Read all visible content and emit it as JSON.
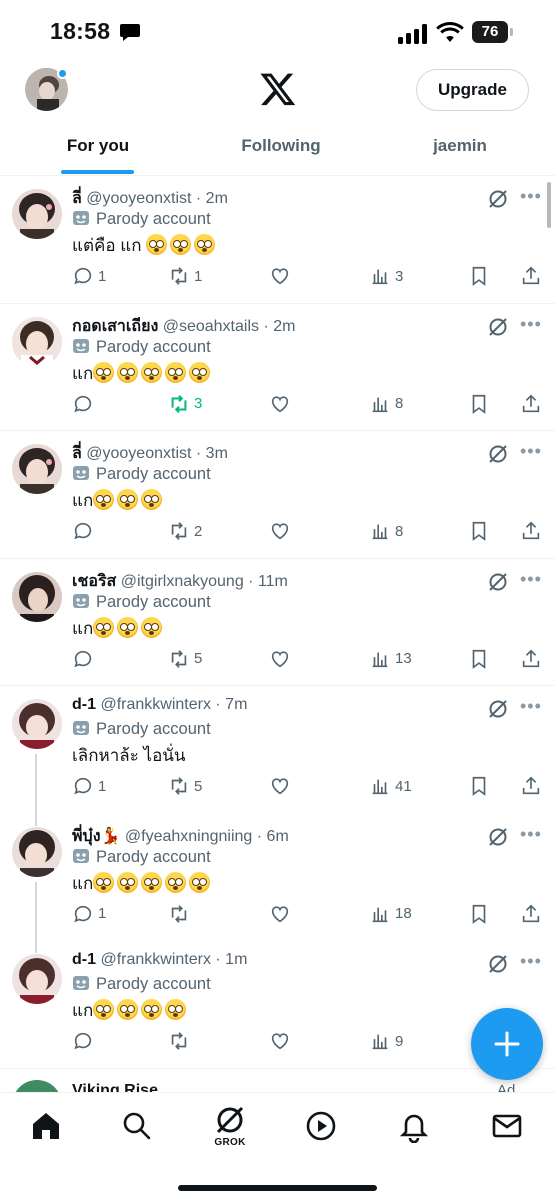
{
  "status_bar": {
    "time": "18:58",
    "battery": "76"
  },
  "header": {
    "logo": "X",
    "upgrade_label": "Upgrade"
  },
  "tabs": [
    {
      "label": "For you",
      "active": true
    },
    {
      "label": "Following",
      "active": false
    },
    {
      "label": "jaemin",
      "active": false
    }
  ],
  "colors": {
    "accent": "#1d9bf0",
    "retweet_active": "#00ba7c",
    "secondary_text": "#536471"
  },
  "posts": [
    {
      "name": "ลี่",
      "handle": "@yooyeonxtist",
      "time": "· 2m",
      "badge": "Parody account",
      "text": "แต่คือ แก",
      "emoji_count": 3,
      "replies": "1",
      "reposts": "1",
      "likes": "",
      "views": "3",
      "reposted": false
    },
    {
      "name": "กอดเสาเถียง",
      "handle": "@seoahxtails",
      "time": "· 2m",
      "badge": "Parody account",
      "text": "แก",
      "emoji_count": 5,
      "replies": "",
      "reposts": "3",
      "likes": "",
      "views": "8",
      "reposted": true
    },
    {
      "name": "ลี่",
      "handle": "@yooyeonxtist",
      "time": "· 3m",
      "badge": "Parody account",
      "text": "แก",
      "emoji_count": 3,
      "replies": "",
      "reposts": "2",
      "likes": "",
      "views": "8",
      "reposted": false
    },
    {
      "name": "เชอริส",
      "handle": "@itgirlxnakyoung",
      "time": "· 11m",
      "badge": "Parody account",
      "text": "แก",
      "emoji_count": 3,
      "replies": "",
      "reposts": "5",
      "likes": "",
      "views": "13",
      "reposted": false
    },
    {
      "name": "d-1",
      "handle": "@frankkwinterx",
      "time": "· 7m",
      "badge": "Parody account",
      "text": "เลิกหาล้ะ ไอนั่น",
      "emoji_count": 0,
      "replies": "1",
      "reposts": "5",
      "likes": "",
      "views": "41",
      "reposted": false
    },
    {
      "name": "พี่บุ๋ง💃",
      "handle": "@fyeahxningniing",
      "time": "· 6m",
      "badge": "Parody account",
      "text": "แก",
      "emoji_count": 5,
      "replies": "1",
      "reposts": "",
      "likes": "",
      "views": "18",
      "reposted": false
    },
    {
      "name": "d-1",
      "handle": "@frankkwinterx",
      "time": "· 1m",
      "badge": "Parody account",
      "text": "แก",
      "emoji_count": 4,
      "replies": "",
      "reposts": "",
      "likes": "",
      "views": "9",
      "reposted": false
    }
  ],
  "ad_post": {
    "name": "Viking Rise",
    "label": "Ad"
  },
  "bottom_nav": {
    "items": [
      "home-icon",
      "search-icon",
      "grok-icon",
      "video-icon",
      "notifications-icon",
      "messages-icon"
    ],
    "grok_label": "GROK"
  }
}
